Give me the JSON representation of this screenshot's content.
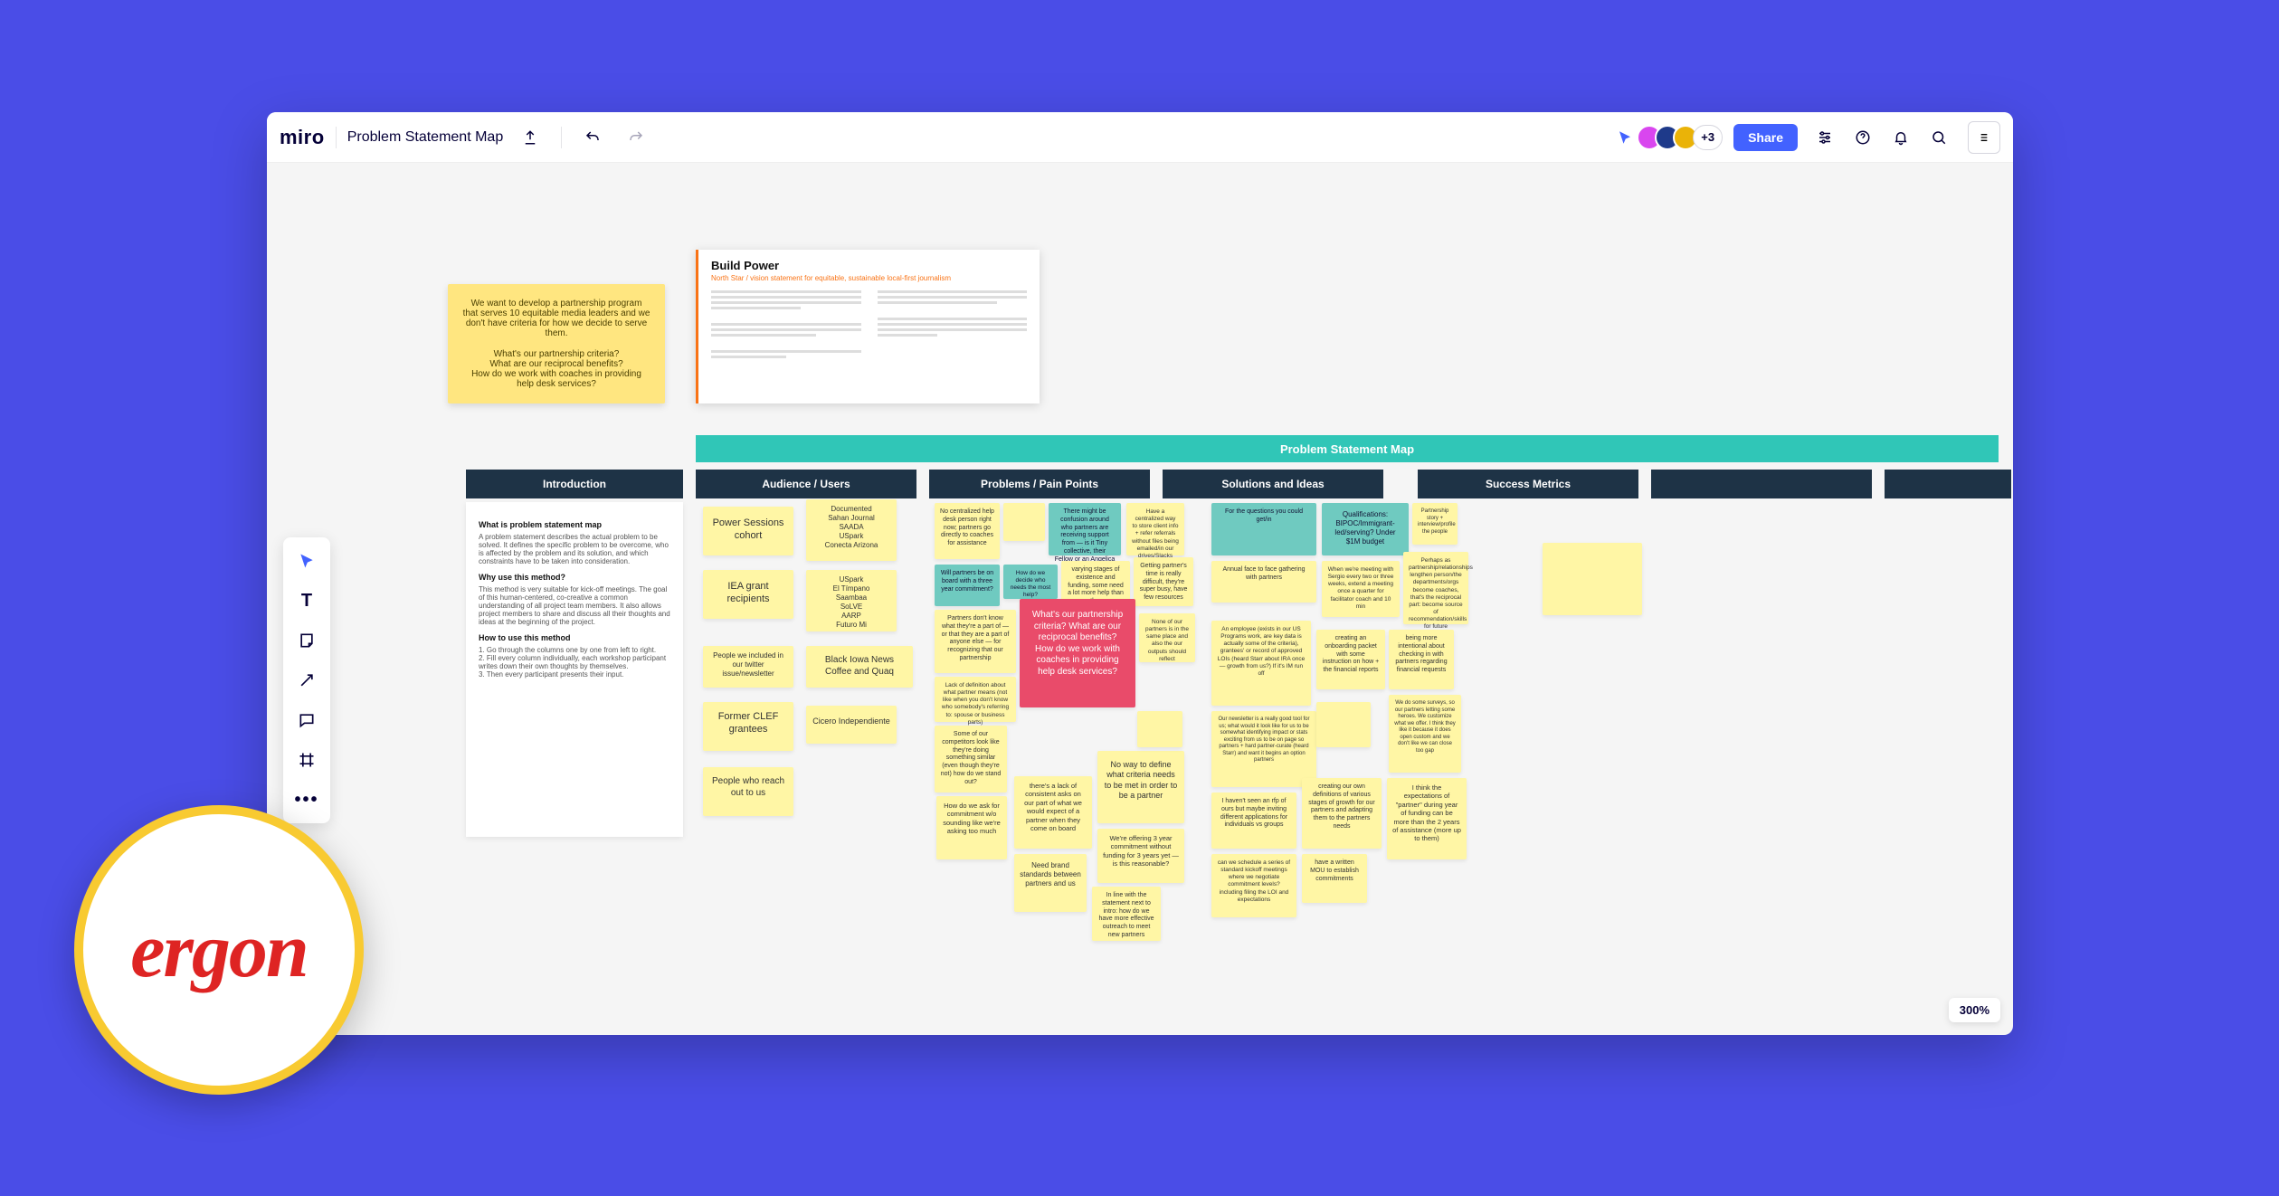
{
  "header": {
    "logo": "miro",
    "board_title": "Problem Statement Map",
    "more_count": "+3",
    "share_label": "Share"
  },
  "zoom": "300%",
  "badge": "ergon",
  "banner": "Problem Statement Map",
  "columns": [
    "Introduction",
    "Audience / Users",
    "Problems / Pain Points",
    "Solutions and Ideas",
    "Success Metrics",
    ""
  ],
  "big_note": {
    "l1": "We want to develop a partnership program that serves 10 equitable media leaders and we don't have criteria for how we decide to serve them.",
    "l2": "What's our partnership criteria?",
    "l3": "What are our reciprocal benefits?",
    "l4": "How do we work with coaches in providing help desk services?"
  },
  "doc": {
    "title": "Build Power",
    "subtitle": "North Star / vision statement for equitable, sustainable local-first journalism"
  },
  "intro_panel": {
    "h1": "What is problem statement map",
    "p1": "A problem statement describes the actual problem to be solved. It defines the specific problem to be overcome, who is affected by the problem and its solution, and which constraints have to be taken into consideration.",
    "h2": "Why use this method?",
    "p2": "This method is very suitable for kick-off meetings. The goal of this human-centered, co-creative a common understanding of all project team members. It also allows project members to share and discuss all their thoughts and ideas at the beginning of the project.",
    "h3": "How to use this method",
    "li1": "1. Go through the columns one by one from left to right.",
    "li2": "2. Fill every column individually, each workshop participant writes down their own thoughts by themselves.",
    "li3": "3. Then every participant presents their input."
  },
  "audience": {
    "n1": "Power Sessions cohort",
    "n2": "Documented\nSahan Journal\nSAADA\nUSpark\nConecta Arizona",
    "n3": "IEA grant recipients",
    "n4": "USpark\nEl Tímpano\nSaambaa\nSoLVE\nAARP\nFuturo Mi",
    "n5": "People we included in our twitter issue/newsletter",
    "n6": "Black Iowa News\nCoffee and Quaq",
    "n7": "Former CLEF grantees",
    "n8": "Cicero Independiente",
    "n9": "People who reach out to us"
  },
  "problems": {
    "n1": "No centralized help desk person right now; partners go directly to coaches for assistance",
    "n2": "There might be confusion around who partners are receiving support from — is it Tiny collective, their Fellow or an Angelica equivalent?",
    "n3": "Have a centralized way to store client info + refer referrals without files being emailed/in our drives/Slacks",
    "n4": "Will partners be on board with a three year commitment?",
    "n5": "How do we decide who needs the most help?",
    "n6": "varying stages of existence and funding, some need a lot more help than others",
    "n7": "Getting partner's time is really difficult, they're super busy, have few resources",
    "n8": "Partners don't know what they're a part of — or that they are a part of anyone else — for recognizing that our partnership",
    "n9": "What's our partnership criteria? What are our reciprocal benefits? How do we work with coaches in providing help desk services?",
    "n10": "None of our partners is in the same place and also the our outputs should reflect",
    "n11": "Lack of definition about what partner means (not like when you don't know who somebody's referring to: spouse or business parts)",
    "n12": "Some of our competitors look like they're doing something similar (even though they're not) how do we stand out?",
    "n13": "How do we ask for commitment w/o sounding like we're asking too much",
    "n14": "there's a lack of consistent asks on our part of what we would expect of a partner when they come on board",
    "n15": "No way to define what criteria needs to be met in order to be a partner",
    "n16": "We're offering 3 year commitment without funding for 3 years yet — is this reasonable?",
    "n17": "Need brand standards between partners and us",
    "n18": "In line with the statement next to intro: how do we have more effective outreach to meet new partners"
  },
  "solutions": {
    "n1": "For the questions you could get/in",
    "n2": "Qualifications: BIPOC/Immigrant-led/serving? Under $1M budget",
    "n3": "Partnership story + interview/profile the people",
    "n4": "Annual face to face gathering with partners",
    "n5": "When we're meeting with Sergio every two or three weeks, extend a meeting once a quarter for facilitator coach and 10 min",
    "n6": "Perhaps as partnership/relationships lengthen person/the departments/orgs become coaches, that's the reciprocal part: become source of recommendation/skills for future",
    "n7": "An employee (exists in our US Programs work, are key data is actually some of the criteria), grantees' or record of approved LOIs (heard Starr about IRA once — growth from us?) If it's IM run off",
    "n8": "creating an onboarding packet with some instruction on how + the financial reports",
    "n9": "being more intentional about checking in with partners regarding financial requests",
    "n10": "Our newsletter is a really good tool for us; what would it look like for us to be somewhat identifying impact or stats exciting from us to be on page so partners + hard partner-curate (heard Starr) and want it begins an option partners",
    "n11": "We do some surveys, so our partners letting some heroes. We customize what we offer. I think they like it because it does open custom and we don't like we can close too gap",
    "n12": "I haven't seen an rfp of ours but maybe inviting different applications for individuals vs groups",
    "n13": "creating our own definitions of various stages of growth for our partners and adapting them to the partners needs",
    "n14": "I think the expectations of \"partner\" during year of funding can be more than the 2 years of assistance (more up to them)",
    "n15": "can we schedule a series of standard kickoff meetings where we negotiate commitment levels? including filing the LOI and expectations",
    "n16": "have a written MOU to establish commitments"
  }
}
